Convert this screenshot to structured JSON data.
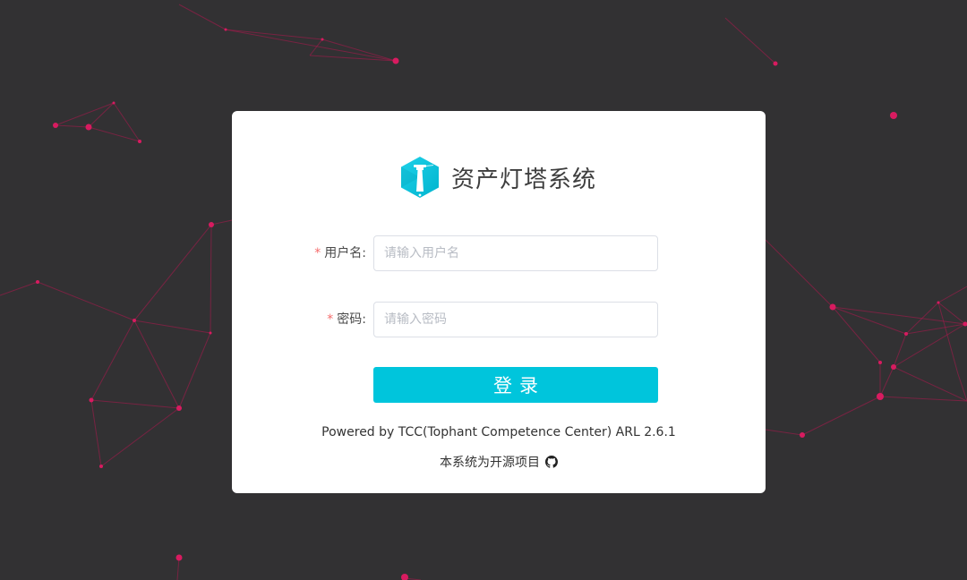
{
  "app": {
    "title": "资产灯塔系统",
    "logo_icon": "lighthouse-icon",
    "accent_color": "#00c5dc"
  },
  "form": {
    "username": {
      "label": "用户名:",
      "required_mark": "*",
      "placeholder": "请输入用户名",
      "value": ""
    },
    "password": {
      "label": "密码:",
      "required_mark": "*",
      "placeholder": "请输入密码",
      "value": ""
    },
    "submit_label": "登录"
  },
  "footer": {
    "powered_by": "Powered by TCC(Tophant Competence Center) ARL 2.6.1",
    "open_source_text": "本系统为开源项目",
    "open_source_icon": "github-icon"
  },
  "colors": {
    "background": "#323133",
    "network_line": "#c2185b",
    "network_node": "#d81b60",
    "button": "#00c5dc",
    "required": "#f56c6c"
  }
}
